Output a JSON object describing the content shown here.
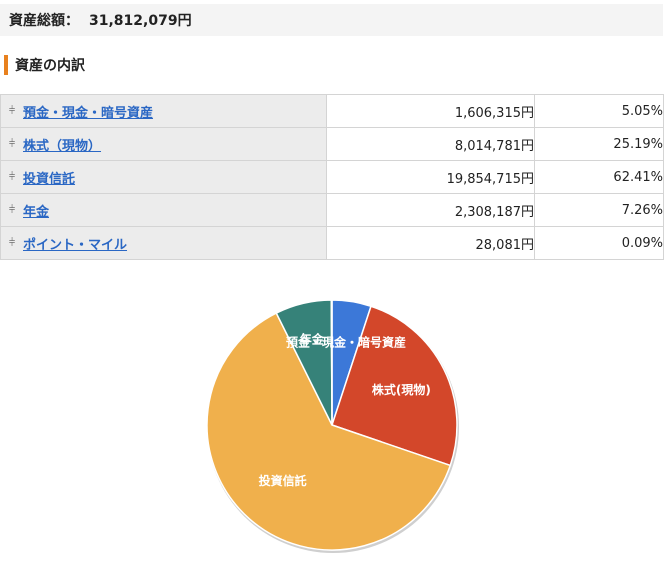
{
  "summary": {
    "total_label": "資産総額：",
    "total_value": "31,812,079円"
  },
  "section": {
    "title": "資産の内訳"
  },
  "table": {
    "rows": [
      {
        "category": "預金・現金・暗号資産",
        "amount": "1,606,315円",
        "percent": "5.05%"
      },
      {
        "category": "株式（現物）",
        "amount": "8,014,781円",
        "percent": "25.19%"
      },
      {
        "category": "投資信託",
        "amount": "19,854,715円",
        "percent": "62.41%"
      },
      {
        "category": "年金",
        "amount": "2,308,187円",
        "percent": "7.26%"
      },
      {
        "category": "ポイント・マイル",
        "amount": "28,081円",
        "percent": "0.09%"
      }
    ]
  },
  "icons": {
    "row_toggle": "chevron-double-down-icon"
  },
  "colors": {
    "accent": "#e8811e",
    "link": "#2a67c4"
  },
  "chart_data": {
    "type": "pie",
    "categories": [
      "預金・現金・暗号資産",
      "株式(現物)",
      "投資信託",
      "年金",
      "ポイント・マイル"
    ],
    "values": [
      5.05,
      25.19,
      62.41,
      7.26,
      0.09
    ],
    "colors": [
      "#3c78d8",
      "#d3472a",
      "#f0b04c",
      "#368279",
      "#6a9e3d"
    ],
    "slice_labels": [
      "預金・現金・暗号資産",
      "株式(現物)",
      "投資信託",
      "年金",
      ""
    ]
  }
}
